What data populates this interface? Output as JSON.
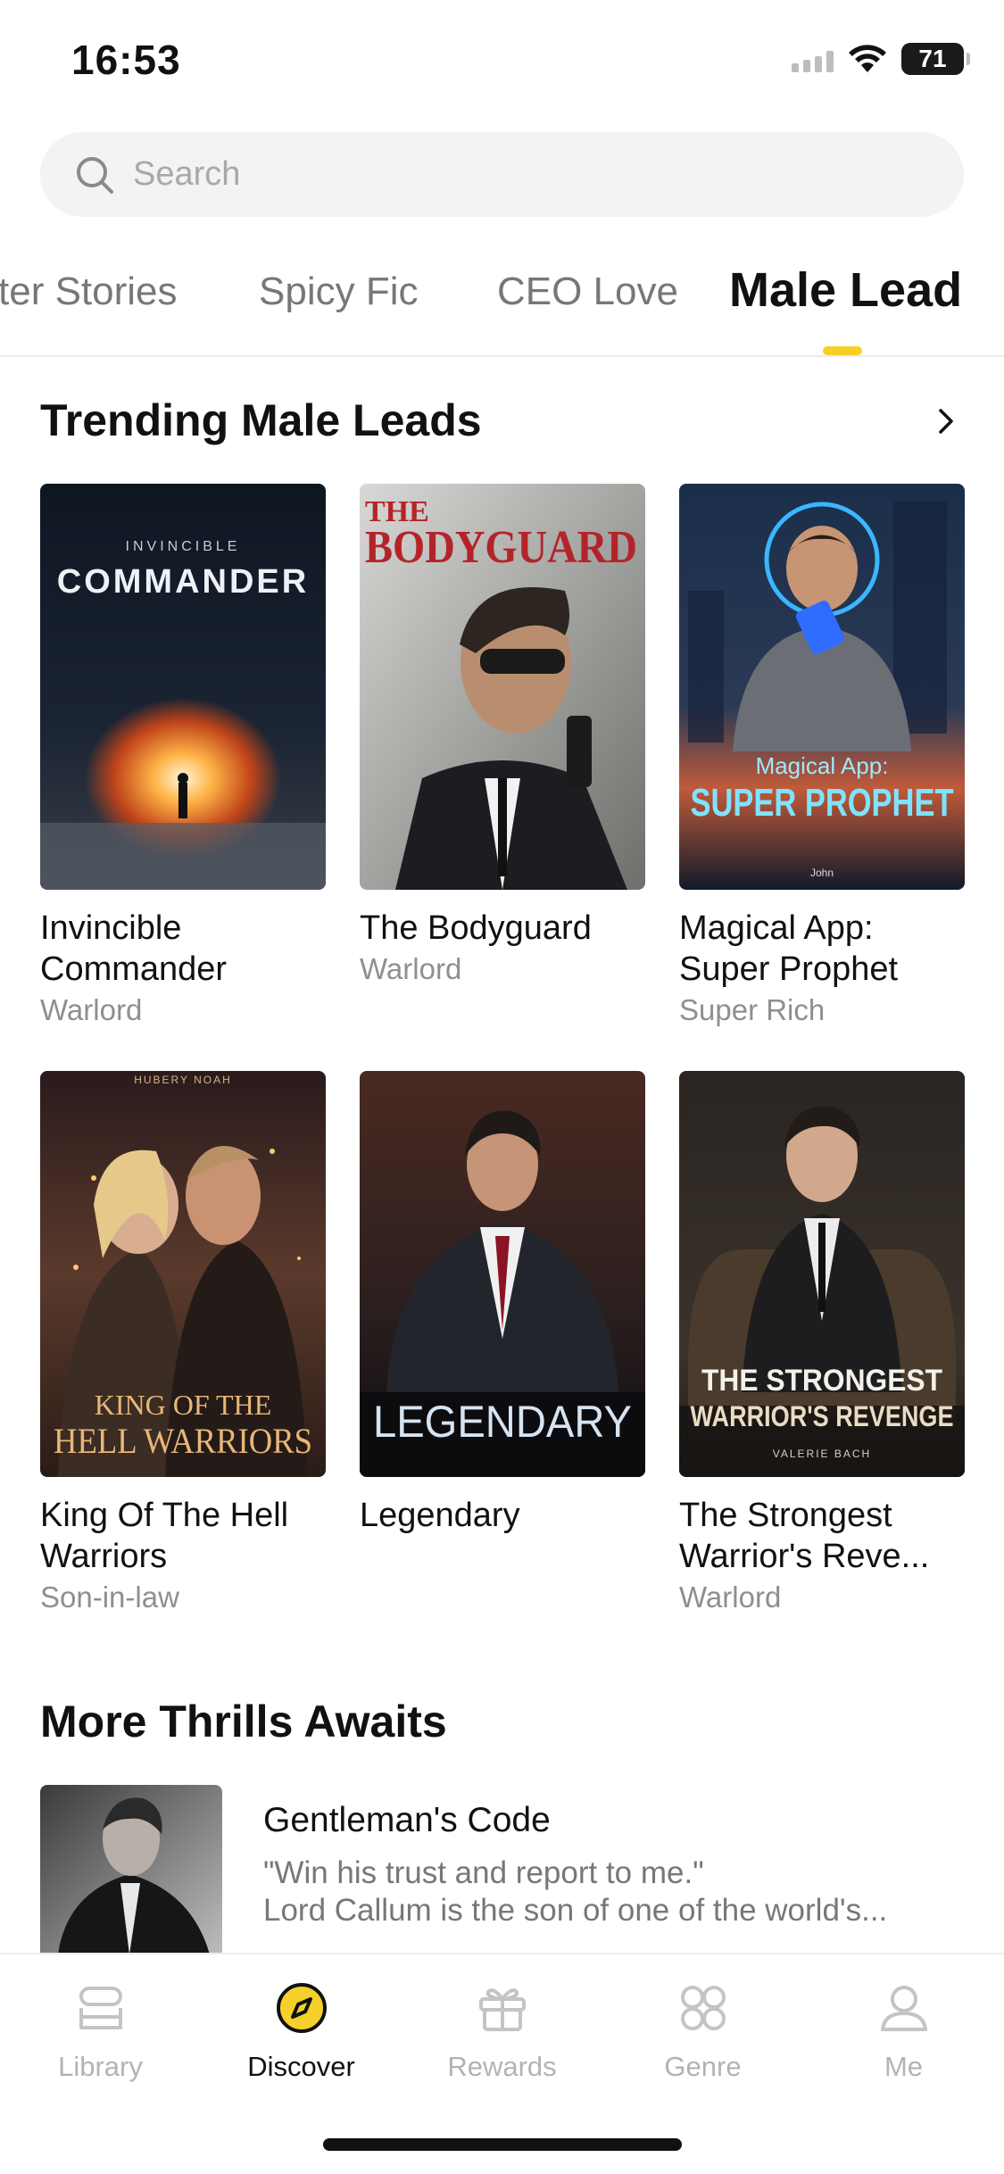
{
  "status_bar": {
    "time": "16:53",
    "battery": "71"
  },
  "search": {
    "placeholder": "Search"
  },
  "tabs": [
    {
      "label": "ter Stories",
      "active": false
    },
    {
      "label": "Spicy Fic",
      "active": false
    },
    {
      "label": "CEO Love",
      "active": false
    },
    {
      "label": "Male Lead",
      "active": true
    }
  ],
  "trending": {
    "title": "Trending Male Leads",
    "books": [
      {
        "title": "Invincible Commander",
        "genre": "Warlord",
        "cover_text": [
          "INVINCIBLE",
          "COMMANDER"
        ]
      },
      {
        "title": "The Bodyguard",
        "genre": "Warlord",
        "cover_text": [
          "THE",
          "BODYGUARD"
        ]
      },
      {
        "title": "Magical App: Super Prophet",
        "genre": "Super Rich",
        "cover_text": [
          "Magical App:",
          "SUPER PROPHET",
          "John"
        ]
      },
      {
        "title": "King Of The Hell Warriors",
        "genre": "Son-in-law",
        "cover_text": [
          "HUBERY NOAH",
          "KING OF THE",
          "HELL WARRIORS"
        ]
      },
      {
        "title": "Legendary",
        "genre": "",
        "cover_text": [
          "LEGENDARY"
        ]
      },
      {
        "title": "The Strongest Warrior's Reve...",
        "genre": "Warlord",
        "cover_text": [
          "THE STRONGEST",
          "WARRIOR'S REVENGE",
          "VALERIE BACH"
        ]
      }
    ]
  },
  "more_thrills": {
    "title": "More Thrills Awaits",
    "item": {
      "title": "Gentleman's Code",
      "desc_line1": "\"Win his trust and report to me.\"",
      "desc_line2": "Lord Callum is the son of one of the world's..."
    }
  },
  "bottom_nav": [
    {
      "label": "Library",
      "icon": "library-icon",
      "active": false
    },
    {
      "label": "Discover",
      "icon": "compass-icon",
      "active": true
    },
    {
      "label": "Rewards",
      "icon": "gift-icon",
      "active": false
    },
    {
      "label": "Genre",
      "icon": "genre-grid-icon",
      "active": false
    },
    {
      "label": "Me",
      "icon": "profile-icon",
      "active": false
    }
  ],
  "colors": {
    "accent": "#f5d02a",
    "inactive_text": "#b3b3b3",
    "secondary_text": "#8f8f8f"
  }
}
